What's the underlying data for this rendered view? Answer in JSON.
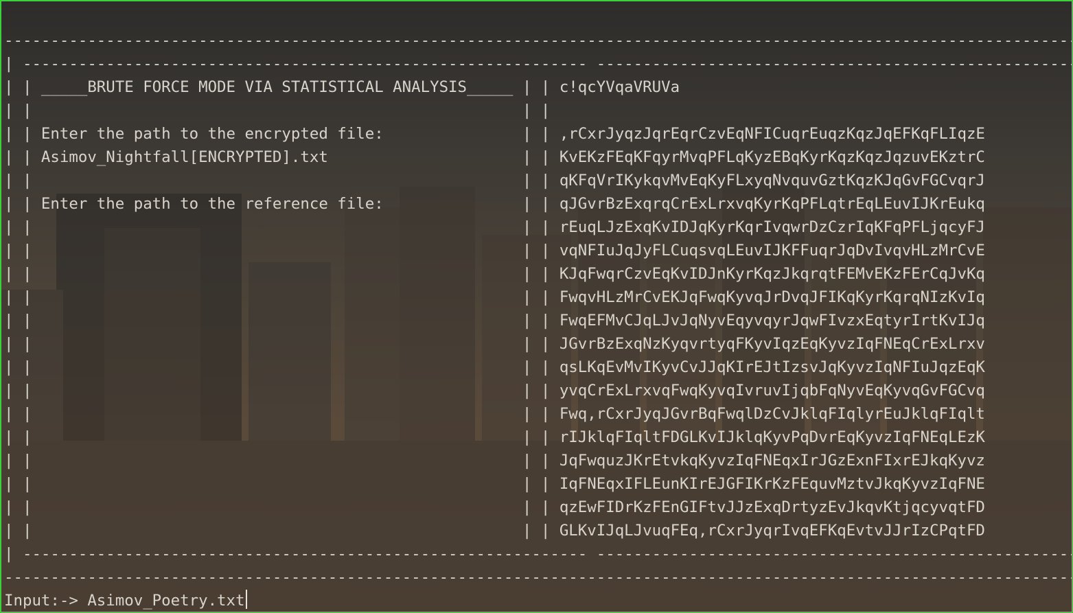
{
  "terminal": {
    "lines": [
      "",
      "-----------------------------------------------------------------------------------------------------------------------------",
      "| ------------------------------------------------------------- ----------------------------------------------------------- |",
      "| | _____BRUTE FORCE MODE VIA STATISTICAL ANALYSIS_____ | | c!qcYVqaVRUVa                                             | |",
      "| |                                                     | |                                                           | |",
      "| | Enter the path to the encrypted file:               | | ,rCxrJyqzJqrEqrCzvEqNFICuqrEuqzKqzJqEFKqFLIqzE            | |",
      "| | Asimov_Nightfall[ENCRYPTED].txt                     | | KvEKzFEqKFqyrMvqPFLqKyzEBqKyrKqzKqzJqzuvEKztrC            | |",
      "| |                                                     | | qKFqVrIKykqvMvEqKyFLxyqNvquvGztKqzKJqGvFGCvqrJ            | |",
      "| | Enter the path to the reference file:               | | qJGvrBzExqrqCrExLrxvqKyrKqPFLqtrEqLEuvIJKrEukq            | |",
      "| |                                                     | | rEuqLJzExqKvIDJqKyrKqrIvqwrDzCzrIqKFqPFLjqcyFJ            | |",
      "| |                                                     | | vqNFIuJqJyFLCuqsvqLEuvIJKFFuqrJqDvIvqvHLzMrCvE            | |",
      "| |                                                     | | KJqFwqrCzvEqKvIDJnKyrKqzJkqrqtFEMvEKzFErCqJvKq            | |",
      "| |                                                     | | FwqvHLzMrCvEKJqFwqKyvqJrDvqJFIKqKyrKqrqNIzKvIq            | |",
      "| |                                                     | | FwqEFMvCJqLJvJqNyvEqyvqyrJqwFIvzxEqtyrIrtKvIJq            | |",
      "| |                                                     | | JGvrBzExqNzKyqvrtyqFKyvIqzEqKyvzIqFNEqCrExLrxv            | |",
      "| |                                                     | | qsLKqEvMvIKyvCvJJqKIrEJtIzsvJqKyvzIqNFIuJqzEqK            | |",
      "| |                                                     | | yvqCrExLrxvqFwqKyvqIvruvIjqbFqNyvEqKyvqGvFGCvq            | |",
      "| |                                                     | | Fwq,rCxrJyqJGvrBqFwqlDzCvJklqFIqlyrEuJklqFIqlt            | |",
      "| |                                                     | | rIJklqFIqltFDGLKvIJklqKyvPqDvrEqKyvzIqFNEqLEzK            | |",
      "| |                                                     | | JqFwquzJKrEtvkqKyvzIqFNEqxIrJGzExnFIxrEJkqKyvz            | |",
      "| |                                                     | | IqFNEqxIFLEunKIrEJGFIKrKzFEquvMztvJkqKyvzIqFNE            | |",
      "| |                                                     | | qzEwFIDrKzFEnGIFtvJJzExqDrtyzEvJkqvKtjqcyvqtFD            | |",
      "| |                                                     | | GLKvIJqLJvuqFEq,rCxrJyqrIvqEFKqEvtvJJrIzCPqtFD            | |",
      "| ------------------------------------------------------------- ----------------------------------------------------------- |",
      "-----------------------------------------------------------------------------------------------------------------------------"
    ],
    "prompt": "Input:-> Asimov_Poetry.txt"
  }
}
